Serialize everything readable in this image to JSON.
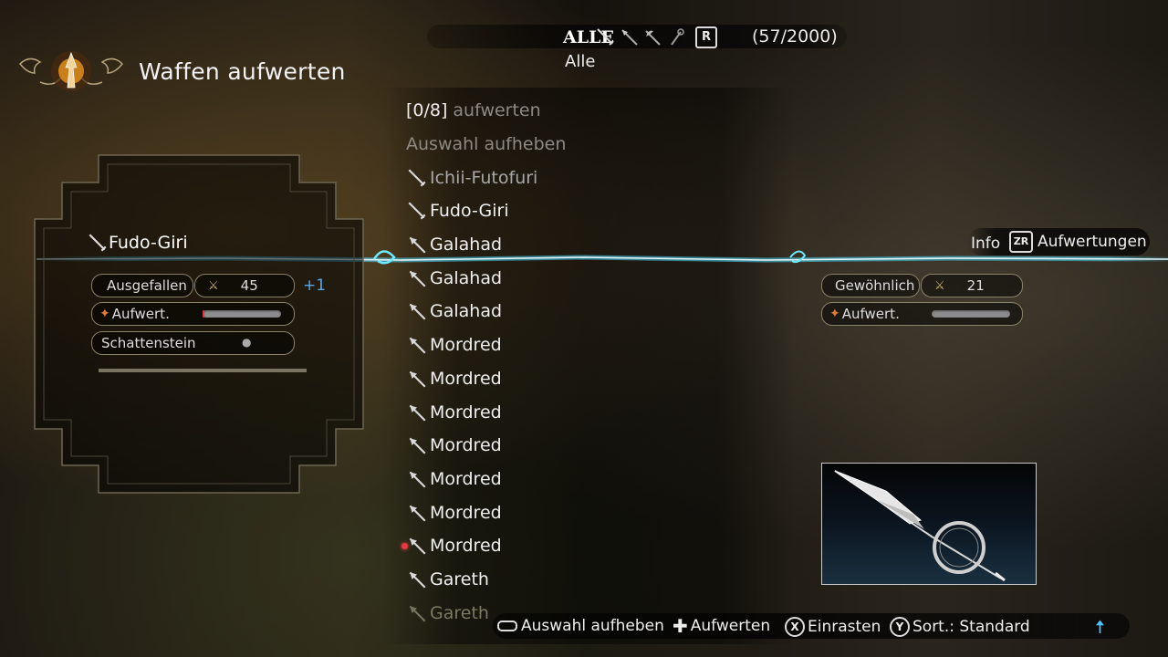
{
  "header": {
    "title": "Waffen aufwerten"
  },
  "filter": {
    "all_label": "ALLE",
    "weapon_type_icons": [
      "sword-icon",
      "spear-icon",
      "axe-icon",
      "staff-icon"
    ],
    "r_button": "R",
    "count": "(57/2000)",
    "current": "Alle"
  },
  "list": {
    "upgrade_counter": "[0/8]",
    "upgrade_label": "aufwerten",
    "deselect_label": "Auswahl aufheben",
    "items": [
      {
        "name": "Ichii-Futofuri",
        "icon": "sword-icon",
        "state": "dim",
        "marker": false
      },
      {
        "name": "Fudo-Giri",
        "icon": "sword-icon",
        "state": "normal",
        "marker": false
      },
      {
        "name": "Galahad",
        "icon": "spear-icon",
        "state": "normal",
        "marker": false
      },
      {
        "name": "Galahad",
        "icon": "spear-icon",
        "state": "normal",
        "marker": false
      },
      {
        "name": "Galahad",
        "icon": "spear-icon",
        "state": "normal",
        "marker": false
      },
      {
        "name": "Mordred",
        "icon": "spear-icon",
        "state": "normal",
        "marker": false
      },
      {
        "name": "Mordred",
        "icon": "spear-icon",
        "state": "normal",
        "marker": false
      },
      {
        "name": "Mordred",
        "icon": "spear-icon",
        "state": "normal",
        "marker": false
      },
      {
        "name": "Mordred",
        "icon": "spear-icon",
        "state": "normal",
        "marker": false
      },
      {
        "name": "Mordred",
        "icon": "spear-icon",
        "state": "normal",
        "marker": false
      },
      {
        "name": "Mordred",
        "icon": "spear-icon",
        "state": "normal",
        "marker": false
      },
      {
        "name": "Mordred",
        "icon": "spear-icon",
        "state": "normal",
        "marker": true
      },
      {
        "name": "Gareth",
        "icon": "spear-icon",
        "state": "normal",
        "marker": false
      },
      {
        "name": "Gareth",
        "icon": "spear-icon",
        "state": "faded",
        "marker": false
      }
    ]
  },
  "current_weapon": {
    "name": "Fudo-Giri",
    "rarity": "Ausgefallen",
    "power": "45",
    "bonus": "+1",
    "upgrade_label": "Aufwert.",
    "upgrade_progress": 0.02,
    "slot": "Schattenstein"
  },
  "target_weapon": {
    "info_label": "Info",
    "zr_button": "ZR",
    "upgrades_label": "Aufwertungen",
    "rarity": "Gewöhnlich",
    "power": "21",
    "upgrade_label": "Aufwert.",
    "upgrade_progress": 0.0
  },
  "footer": {
    "deselect": "Auswahl aufheben",
    "upgrade": "Aufwerten",
    "x_button": "X",
    "lock": "Einrasten",
    "y_button": "Y",
    "sort": "Sort.: Standard",
    "arrow": "🠅"
  },
  "colors": {
    "accent_cyan": "#4fd8ff",
    "pill_border": "#8b8169",
    "bonus_blue": "#5aa7e8",
    "marker_red": "#e23a4a"
  }
}
